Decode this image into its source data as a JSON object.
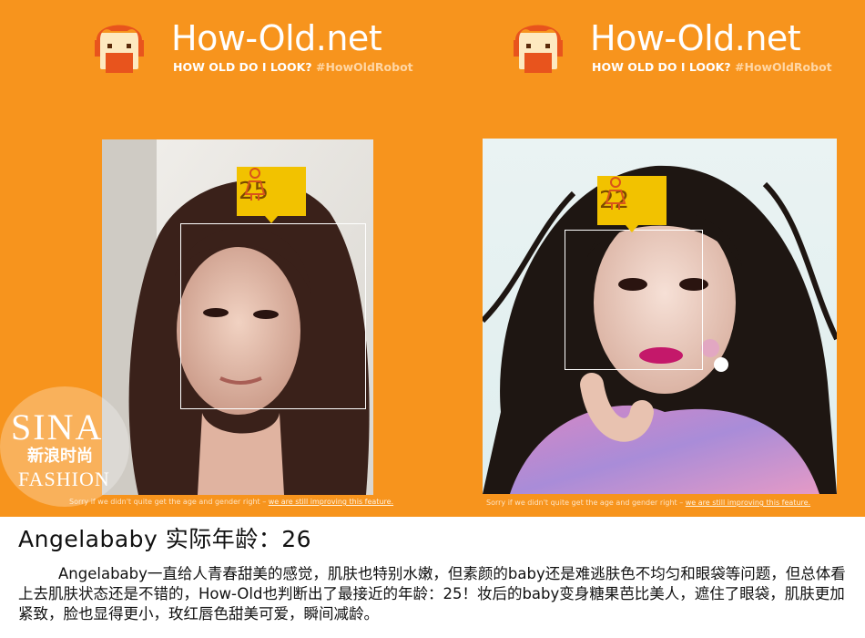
{
  "header_left": {
    "brand": "How-Old.net",
    "tagline": "HOW OLD DO I LOOK?",
    "hashtag": "#HowOldRobot",
    "logo_icon": "robot-face-icon"
  },
  "header_right": {
    "brand": "How-Old.net",
    "tagline": "HOW OLD DO I LOOK?",
    "hashtag": "#HowOldRobot",
    "logo_icon": "robot-face-icon"
  },
  "result_left": {
    "age": "25",
    "gender_icon": "female-icon",
    "disclaimer": "Sorry if we didn't quite get the age and gender right – ",
    "disclaimer_link": "we are still improving this feature."
  },
  "result_right": {
    "age": "22",
    "gender_icon": "female-icon",
    "disclaimer": "Sorry if we didn't quite get the age and gender right – ",
    "disclaimer_link": "we are still improving this feature."
  },
  "watermark": {
    "line1": "SINA",
    "line2": "新浪时尚",
    "line3": "FASHION"
  },
  "caption": {
    "title": "Angelababy  实际年龄：26",
    "body": "Angelababy一直给人青春甜美的感觉，肌肤也特别水嫩，但素颜的baby还是难逃肤色不均匀和眼袋等问题，但总体看上去肌肤状态还是不错的，How-Old也判断出了最接近的年龄：25！妆后的baby变身糖果芭比美人，遮住了眼袋，肌肤更加紧致，脸也显得更小，玫红唇色甜美可爱，瞬间减龄。"
  },
  "colors": {
    "background_orange": "#f7941d",
    "badge_yellow": "#f2c200",
    "logo_red": "#e8541d",
    "logo_cream": "#fde9c0"
  }
}
